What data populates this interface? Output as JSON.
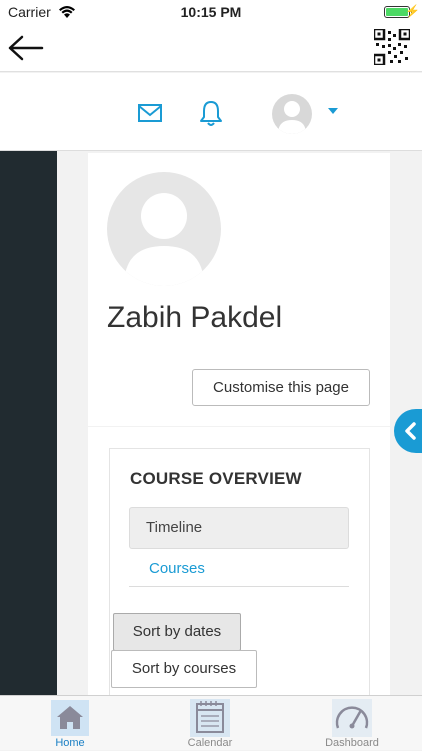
{
  "status_bar": {
    "carrier": "Carrier",
    "time": "10:15 PM"
  },
  "profile": {
    "name": "Zabih Pakdel",
    "customise_label": "Customise this page"
  },
  "course_overview": {
    "title": "COURSE OVERVIEW",
    "tabs": [
      "Timeline",
      "Courses"
    ],
    "sort_options": [
      "Sort by dates",
      "Sort by courses"
    ]
  },
  "tab_bar": {
    "items": [
      "Home",
      "Calendar",
      "Dashboard"
    ]
  },
  "colors": {
    "accent": "#1a9bd4",
    "sidebar": "#212b30",
    "battery": "#4cd964"
  },
  "icons": [
    "wifi-icon",
    "battery-icon",
    "back-arrow-icon",
    "qr-code-icon",
    "mail-icon",
    "bell-icon",
    "user-avatar-icon",
    "chevron-left-icon",
    "home-icon",
    "calendar-icon",
    "dashboard-icon"
  ]
}
